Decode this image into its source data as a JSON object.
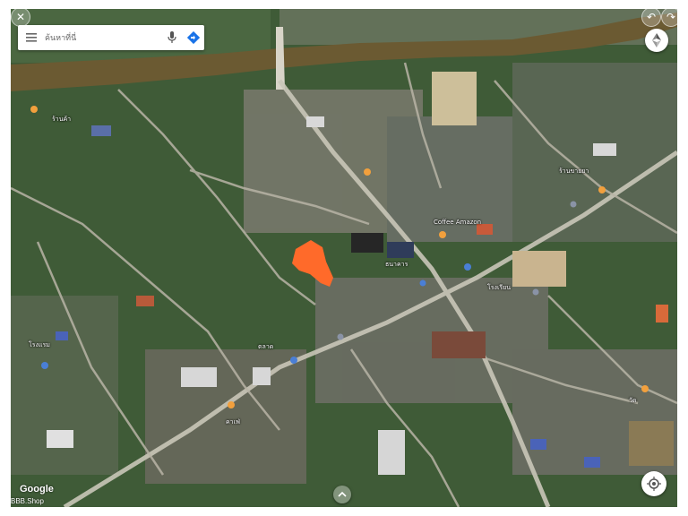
{
  "search": {
    "placeholder": "ค้นหาที่นี่"
  },
  "icons": {
    "menu": "menu-icon",
    "mic": "mic-icon",
    "directions": "directions-icon",
    "compass": "compass-icon",
    "location": "my-location-icon",
    "expand": "chevron-up-icon",
    "back": "back-icon",
    "close": "close-icon",
    "forward": "forward-icon"
  },
  "map": {
    "highlight_color": "#ff6a2a",
    "poi_color": "#f2a03d",
    "river_color": "#6b5a32"
  },
  "labels": {
    "coffee": "Coffee Amazon",
    "pharmacy": "ร้านขายยา",
    "bank": "ธนาคาร",
    "school": "โรงเรียน",
    "wat": "วัด",
    "market": "ตลาด",
    "hotel": "โรงแรม",
    "cafe": "คาเฟ่",
    "shop": "ร้านค้า"
  },
  "footer": {
    "google": "Google",
    "attribution": "BBB.Shop"
  }
}
